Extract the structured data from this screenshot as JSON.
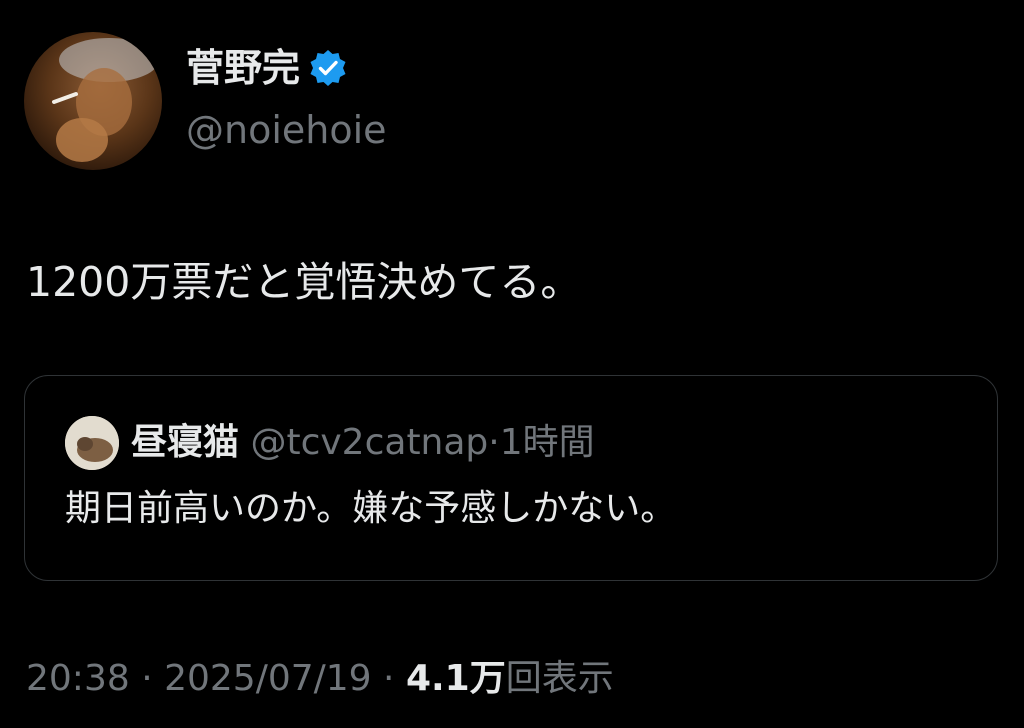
{
  "author": {
    "display_name": "菅野完",
    "handle": "@noiehoie",
    "verified_icon": "verified-badge-icon",
    "verified_color": "#1d9bf0"
  },
  "tweet": {
    "text": "1200万票だと覚悟決めてる。"
  },
  "quote": {
    "display_name": "昼寝猫",
    "handle": "@tcv2catnap",
    "separator": "·",
    "time": "1時間",
    "text": "期日前高いのか。嫌な予感しかない。"
  },
  "meta": {
    "time": "20:38",
    "sep1": " · ",
    "date": "2025/07/19",
    "sep2": " · ",
    "views_count": "4.1万",
    "views_label": "回表示"
  },
  "colors": {
    "background": "#000000",
    "primary_text": "#e7e9ea",
    "secondary_text": "#71767b",
    "border": "#2f3336"
  }
}
